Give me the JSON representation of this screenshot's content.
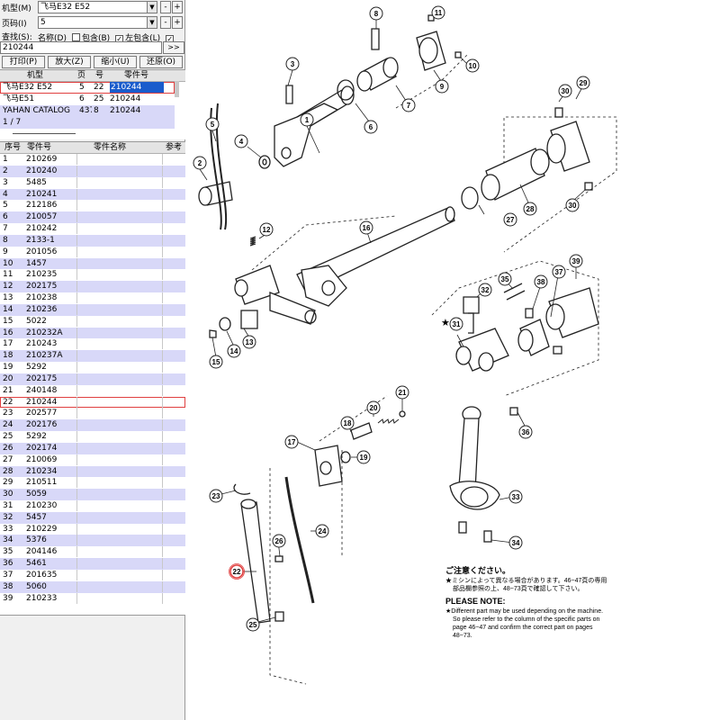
{
  "fields": {
    "model": {
      "label": "机型(M)",
      "value": "飞马E32 E52"
    },
    "page": {
      "label": "页码(I)",
      "value": "5"
    },
    "search": {
      "label": "查找(S):",
      "opt_name": "名称(D)",
      "opt_include": "包含(B)",
      "opt_left": "左包含(L)",
      "value": "210244",
      "go": ">>"
    },
    "minus": "-",
    "plus": "+"
  },
  "toolbar": {
    "print": "打印(P)",
    "zoom_in": "放大(Z)",
    "zoom_out": "缩小(U)",
    "restore": "还原(O)"
  },
  "catalog_table": {
    "headers": [
      "机型",
      "页",
      "号",
      "零件号"
    ],
    "rows": [
      {
        "model": "飞马E32 E52",
        "page": "5",
        "no": "22",
        "part": "210244"
      },
      {
        "model": "飞马E51",
        "page": "6",
        "no": "25",
        "part": "210244"
      },
      {
        "model": "YAHAN CATALOG",
        "page": "437",
        "no": "8",
        "part": "210244"
      }
    ],
    "pager": "1 / 7"
  },
  "parts_table": {
    "headers": [
      "序号",
      "零件号",
      "零件名称",
      "参考"
    ],
    "rows": [
      {
        "no": "1",
        "part": "210269"
      },
      {
        "no": "2",
        "part": "210240"
      },
      {
        "no": "3",
        "part": "5485"
      },
      {
        "no": "4",
        "part": "210241"
      },
      {
        "no": "5",
        "part": "212186"
      },
      {
        "no": "6",
        "part": "210057"
      },
      {
        "no": "7",
        "part": "210242"
      },
      {
        "no": "8",
        "part": "2133-1"
      },
      {
        "no": "9",
        "part": "201056"
      },
      {
        "no": "10",
        "part": "1457"
      },
      {
        "no": "11",
        "part": "210235"
      },
      {
        "no": "12",
        "part": "202175"
      },
      {
        "no": "13",
        "part": "210238"
      },
      {
        "no": "14",
        "part": "210236"
      },
      {
        "no": "15",
        "part": "5022"
      },
      {
        "no": "16",
        "part": "210232A"
      },
      {
        "no": "17",
        "part": "210243"
      },
      {
        "no": "18",
        "part": "210237A"
      },
      {
        "no": "19",
        "part": "5292"
      },
      {
        "no": "20",
        "part": "202175"
      },
      {
        "no": "21",
        "part": "240148"
      },
      {
        "no": "22",
        "part": "210244"
      },
      {
        "no": "23",
        "part": "202577"
      },
      {
        "no": "24",
        "part": "202176"
      },
      {
        "no": "25",
        "part": "5292"
      },
      {
        "no": "26",
        "part": "202174"
      },
      {
        "no": "27",
        "part": "210069"
      },
      {
        "no": "28",
        "part": "210234"
      },
      {
        "no": "29",
        "part": "210511"
      },
      {
        "no": "30",
        "part": "5059"
      },
      {
        "no": "31",
        "part": "210230"
      },
      {
        "no": "32",
        "part": "5457"
      },
      {
        "no": "33",
        "part": "210229"
      },
      {
        "no": "34",
        "part": "5376"
      },
      {
        "no": "35",
        "part": "204146"
      },
      {
        "no": "36",
        "part": "5461"
      },
      {
        "no": "37",
        "part": "201635"
      },
      {
        "no": "38",
        "part": "5060"
      },
      {
        "no": "39",
        "part": "210233"
      }
    ]
  },
  "diagram": {
    "callouts": [
      "1",
      "2",
      "3",
      "4",
      "5",
      "6",
      "7",
      "8",
      "9",
      "10",
      "11",
      "12",
      "13",
      "14",
      "15",
      "16",
      "17",
      "18",
      "19",
      "20",
      "21",
      "22",
      "23",
      "24",
      "25",
      "26",
      "27",
      "28",
      "29",
      "30",
      "30",
      "31",
      "32",
      "33",
      "34",
      "35",
      "36",
      "37",
      "38",
      "39"
    ],
    "highlight_callout": "22",
    "star": "★",
    "note_jp_title": "ご注意ください。",
    "note_jp_1": "★ミシンによって異なる場合があります。46~47頁の専用",
    "note_jp_2": "部品欄参照の上、48~73頁で確認して下さい。",
    "note_en_title": "PLEASE NOTE:",
    "note_en_1": "★Different part may be used depending on the machine.",
    "note_en_2": "So please refer to the column of the specific parts on",
    "note_en_3": "page 46~47 and confirm the correct part on pages",
    "note_en_4": "48~73."
  },
  "colors": {
    "selected_blue": "#1a5ccc",
    "row_alt": "#d8d8f8",
    "highlight_red": "#e04040"
  }
}
